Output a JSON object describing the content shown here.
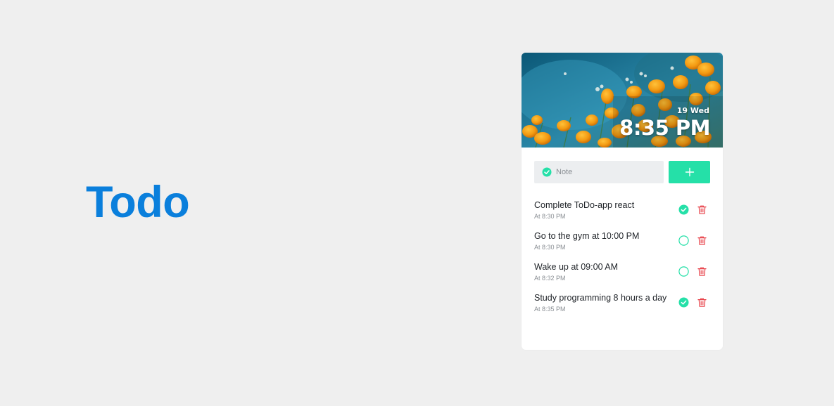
{
  "brand": {
    "title": "Todo"
  },
  "colors": {
    "brand_blue": "#0a7fdc",
    "accent_green": "#25e0a8",
    "delete_red": "#e8424a",
    "background": "#efefef"
  },
  "hero": {
    "date": "19 Wed",
    "time": "8:35 PM",
    "image": "orange-poppies-photo"
  },
  "input": {
    "placeholder": "Note",
    "value": "",
    "icon": "check-circle-icon",
    "add_icon": "plus-icon"
  },
  "todos": [
    {
      "title": "Complete ToDo-app react",
      "time": "At 8:30 PM",
      "done": true
    },
    {
      "title": "Go to the gym at 10:00 PM",
      "time": "At 8:30 PM",
      "done": false
    },
    {
      "title": "Wake up at 09:00 AM",
      "time": "At 8:32 PM",
      "done": false
    },
    {
      "title": "Study programming 8 hours a day",
      "time": "At 8:35 PM",
      "done": true
    }
  ]
}
